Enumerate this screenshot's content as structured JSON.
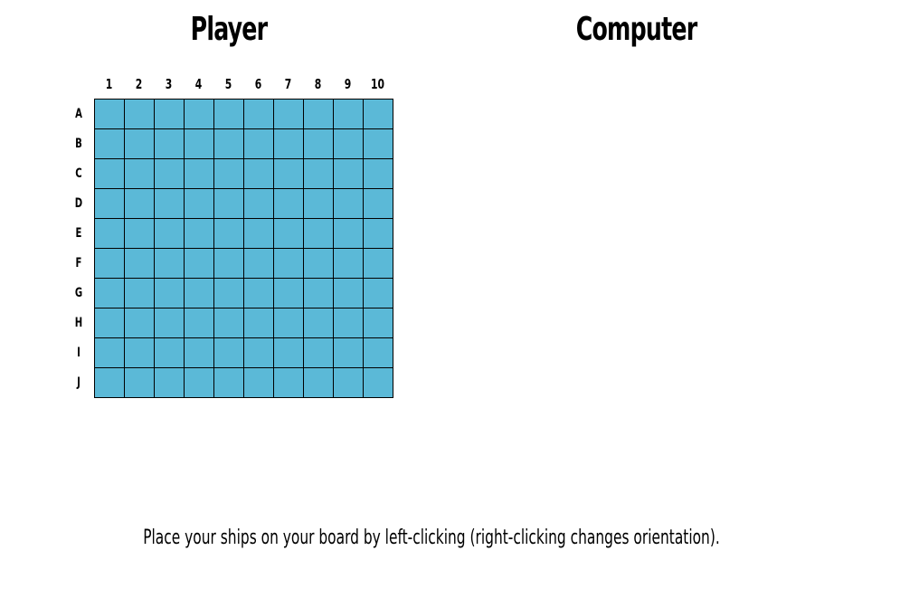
{
  "titles": {
    "player": "Player",
    "computer": "Computer"
  },
  "board": {
    "columns": [
      "1",
      "2",
      "3",
      "4",
      "5",
      "6",
      "7",
      "8",
      "9",
      "10"
    ],
    "rows": [
      "A",
      "B",
      "C",
      "D",
      "E",
      "F",
      "G",
      "H",
      "I",
      "J"
    ],
    "water_color": "#5bb9d7",
    "grid_line_color": "#000000"
  },
  "status": {
    "message": "Place your ships on your board by left-clicking (right-clicking changes orientation)."
  }
}
